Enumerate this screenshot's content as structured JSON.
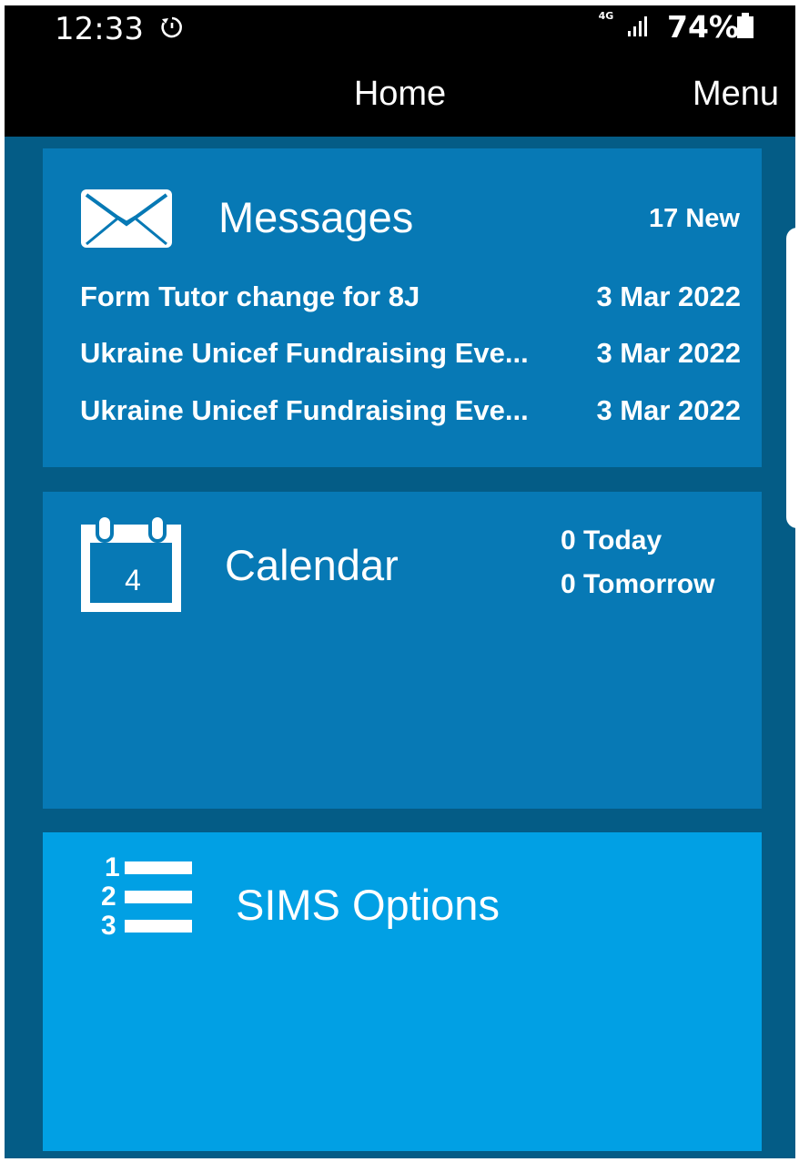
{
  "status_bar": {
    "time": "12:33",
    "network": "4G",
    "battery": "74%"
  },
  "app_bar": {
    "title": "Home",
    "menu": "Menu"
  },
  "messages": {
    "title": "Messages",
    "count": "17 New",
    "items": [
      {
        "subject": "Form Tutor change for 8J",
        "date": "3 Mar 2022"
      },
      {
        "subject": "Ukraine Unicef Fundraising Eve...",
        "date": "3 Mar 2022"
      },
      {
        "subject": "Ukraine Unicef Fundraising Eve...",
        "date": "3 Mar 2022"
      }
    ]
  },
  "calendar": {
    "title": "Calendar",
    "icon_day": "4",
    "today": "0 Today",
    "tomorrow": "0 Tomorrow"
  },
  "sims": {
    "title": "SIMS Options",
    "icon_numbers": [
      "1",
      "2",
      "3"
    ]
  },
  "colors": {
    "app_background": "#045c86",
    "tile_dark": "#0779b5",
    "tile_light": "#01a0e4",
    "bar": "#000000",
    "text": "#ffffff"
  },
  "icons": {
    "messages": "envelope-icon",
    "calendar": "calendar-icon",
    "sims": "numbered-list-icon",
    "status_timer": "timer-icon",
    "status_signal": "signal-icon",
    "status_battery": "battery-icon"
  }
}
